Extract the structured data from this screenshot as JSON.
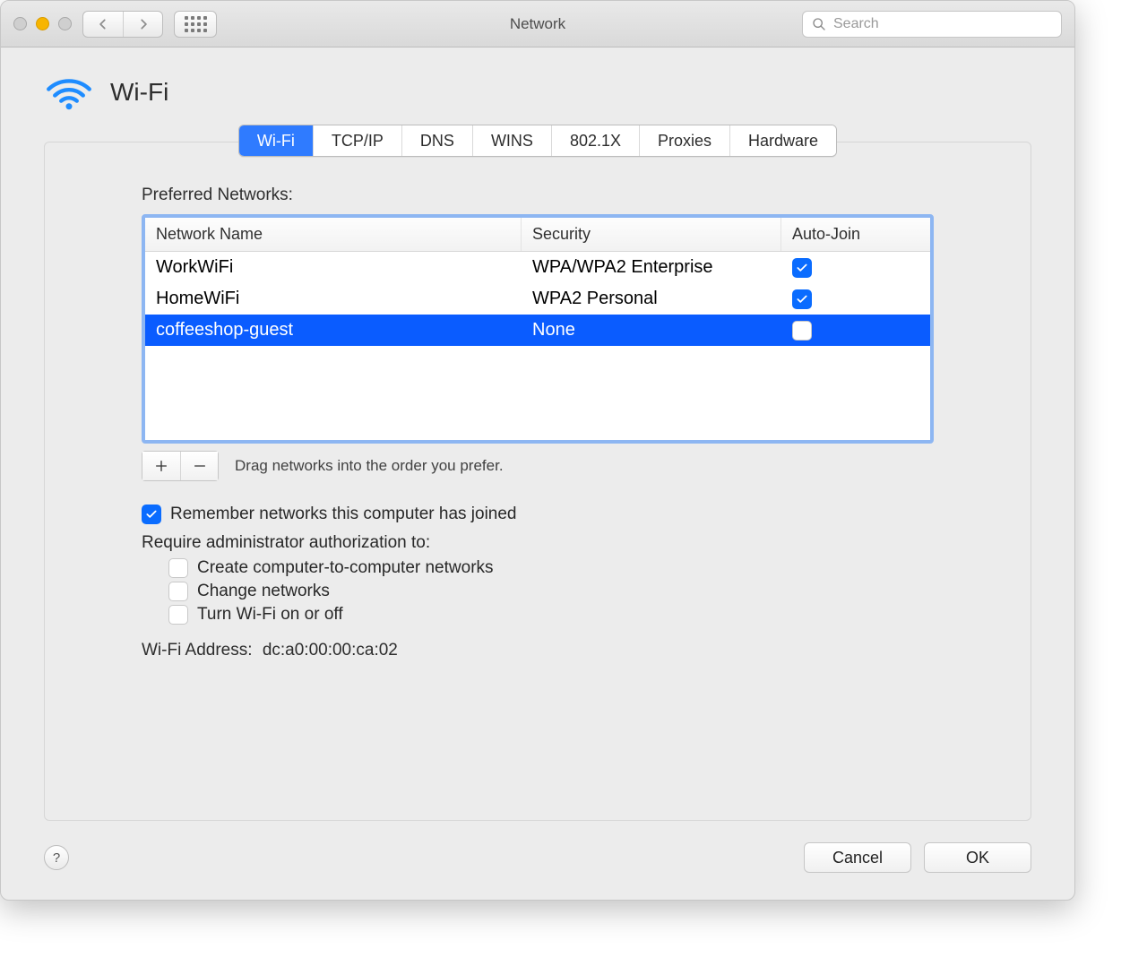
{
  "window": {
    "title": "Network"
  },
  "toolbar": {
    "search_placeholder": "Search"
  },
  "header": {
    "title": "Wi-Fi"
  },
  "tabs": [
    {
      "label": "Wi-Fi",
      "active": true
    },
    {
      "label": "TCP/IP",
      "active": false
    },
    {
      "label": "DNS",
      "active": false
    },
    {
      "label": "WINS",
      "active": false
    },
    {
      "label": "802.1X",
      "active": false
    },
    {
      "label": "Proxies",
      "active": false
    },
    {
      "label": "Hardware",
      "active": false
    }
  ],
  "preferred": {
    "label": "Preferred Networks:",
    "columns": {
      "name": "Network Name",
      "security": "Security",
      "autojoin": "Auto-Join"
    },
    "rows": [
      {
        "name": "WorkWiFi",
        "security": "WPA/WPA2 Enterprise",
        "autojoin": true,
        "selected": false
      },
      {
        "name": "HomeWiFi",
        "security": "WPA2 Personal",
        "autojoin": true,
        "selected": false
      },
      {
        "name": "coffeeshop-guest",
        "security": "None",
        "autojoin": false,
        "selected": true
      }
    ],
    "hint": "Drag networks into the order you prefer."
  },
  "options": {
    "remember": {
      "label": "Remember networks this computer has joined",
      "checked": true
    },
    "require_label": "Require administrator authorization to:",
    "create": {
      "label": "Create computer-to-computer networks",
      "checked": false
    },
    "change": {
      "label": "Change networks",
      "checked": false
    },
    "toggle": {
      "label": "Turn Wi-Fi on or off",
      "checked": false
    }
  },
  "address": {
    "label": "Wi-Fi Address:",
    "value": "dc:a0:00:00:ca:02"
  },
  "footer": {
    "cancel": "Cancel",
    "ok": "OK"
  }
}
